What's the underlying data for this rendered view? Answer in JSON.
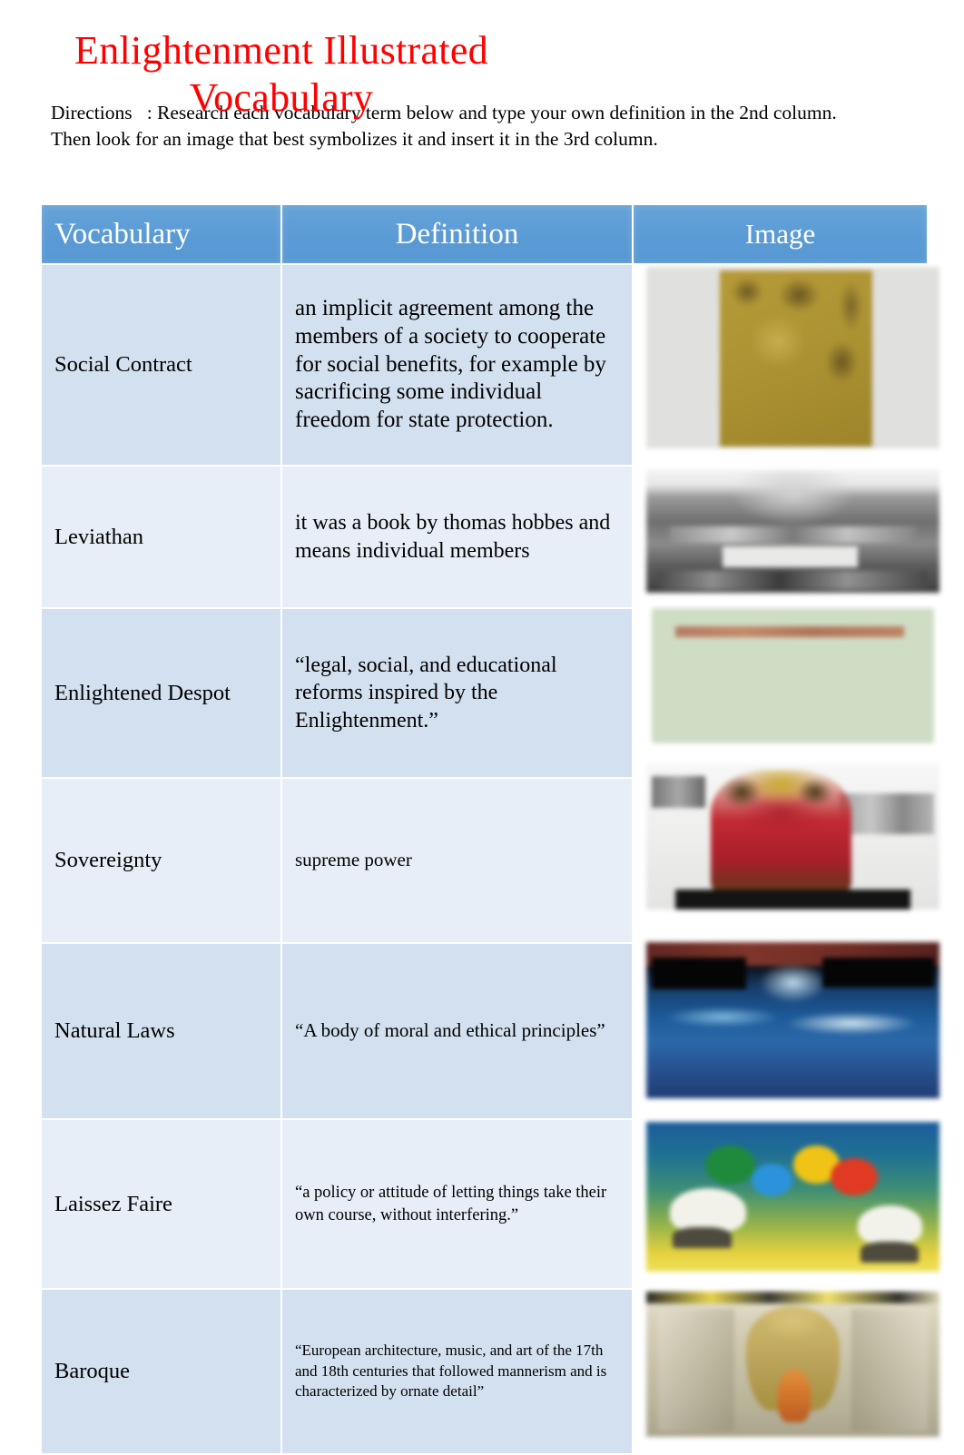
{
  "document": {
    "title": "Enlightenment Illustrated Vocabulary",
    "title_color": "#FF0000",
    "directions_label": "Directions   ",
    "directions_text": ": Research each vocabulary term below and type your own definition in the 2nd column. Then look for an image that best symbolizes it and insert it in the 3rd column."
  },
  "table": {
    "header_color": "#5B9BD5",
    "row_color_dark": "#D3E0EF",
    "row_color_light": "#E7EEF7",
    "columns": [
      {
        "label": "Vocabulary"
      },
      {
        "label": "Definition"
      },
      {
        "label": "Image"
      }
    ],
    "rows": [
      {
        "vocabulary": "Social Contract",
        "definition": "an implicit agreement among the members of a society to cooperate for social benefits, for example by sacrificing some individual freedom for state protection.",
        "image_name": "golden-parchment-image"
      },
      {
        "vocabulary": "Leviathan",
        "definition": "it was a book by thomas hobbes    and means individual members",
        "image_name": "leviathan-engraving-image"
      },
      {
        "vocabulary": "Enlightened Despot",
        "definition": "“legal, social, and educational reforms inspired by the Enlightenment.”",
        "image_name": "green-crown-card-image"
      },
      {
        "vocabulary": "Sovereignty",
        "definition": "supreme power",
        "image_name": "red-gold-crown-image"
      },
      {
        "vocabulary": "Natural Laws",
        "definition": "“A body of moral and ethical principles”",
        "image_name": "blue-nature-image"
      },
      {
        "vocabulary": "Laissez Faire",
        "definition": "“a policy or attitude of letting things take their own course, without interfering.”",
        "image_name": "colored-circles-landscape-image"
      },
      {
        "vocabulary": "Baroque",
        "definition": "“European architecture, music, and art of the 17th and 18th centuries that followed mannerism and is characterized by ornate detail”",
        "image_name": "baroque-architecture-image"
      }
    ]
  }
}
